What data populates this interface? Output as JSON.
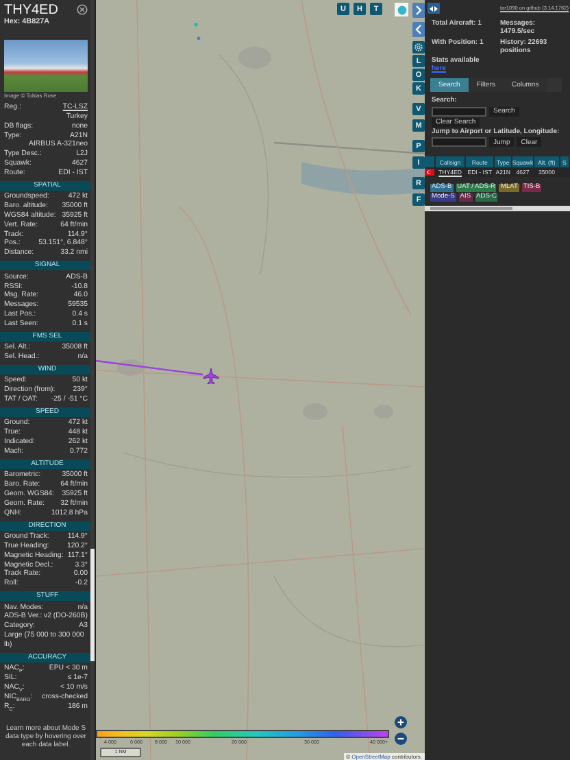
{
  "aircraft": {
    "callsign": "THY4ED",
    "hex": "Hex: 4B827A",
    "photo_credit": "Image © Tobias Rose"
  },
  "details": [
    {
      "kind": "link",
      "label": "Reg.:",
      "value": "TC-LSZ"
    },
    {
      "kind": "note",
      "value": "Turkey"
    },
    {
      "kind": "pair",
      "label": "DB flags:",
      "value": "none"
    },
    {
      "kind": "pair",
      "label": "Type:",
      "value": "A21N"
    },
    {
      "kind": "note",
      "value": "AIRBUS A-321neo"
    },
    {
      "kind": "pair",
      "label": "Type Desc.:",
      "value": "L2J"
    },
    {
      "kind": "pair",
      "label": "Squawk:",
      "value": "4627"
    },
    {
      "kind": "pair",
      "label": "Route:",
      "value": "EDI - IST"
    }
  ],
  "sections": [
    {
      "title": "SPATIAL",
      "rows": [
        {
          "kind": "pair",
          "label": "Groundspeed:",
          "value": "472 kt"
        },
        {
          "kind": "pair",
          "label": "Baro. altitude:",
          "value": "35000 ft"
        },
        {
          "kind": "pair",
          "label": "WGS84 altitude:",
          "value": "35925 ft"
        },
        {
          "kind": "pair",
          "label": "Vert. Rate:",
          "value": "64 ft/min"
        },
        {
          "kind": "pair",
          "label": "Track:",
          "value": "114.9°"
        },
        {
          "kind": "pair",
          "label": "Pos.:",
          "value": "53.151°, 6.848°"
        },
        {
          "kind": "pair",
          "label": "Distance:",
          "value": "33.2 nmi"
        }
      ]
    },
    {
      "title": "SIGNAL",
      "rows": [
        {
          "kind": "pair",
          "label": "Source:",
          "value": "ADS-B"
        },
        {
          "kind": "pair",
          "label": "RSSI:",
          "value": "-10.8"
        },
        {
          "kind": "pair",
          "label": "Msg. Rate:",
          "value": "46.0"
        },
        {
          "kind": "pair",
          "label": "Messages:",
          "value": "59535"
        },
        {
          "kind": "pair",
          "label": "Last Pos.:",
          "value": "0.4 s"
        },
        {
          "kind": "pair",
          "label": "Last Seen:",
          "value": "0.1 s"
        }
      ]
    },
    {
      "title": "FMS SEL",
      "rows": [
        {
          "kind": "pair",
          "label": "Sel. Alt.:",
          "value": "35008 ft"
        },
        {
          "kind": "pair",
          "label": "Sel. Head.:",
          "value": "n/a"
        }
      ]
    },
    {
      "title": "WIND",
      "rows": [
        {
          "kind": "pair",
          "label": "Speed:",
          "value": "50 kt"
        },
        {
          "kind": "pair",
          "label": "Direction (from):",
          "value": "239°"
        },
        {
          "kind": "pair",
          "label": "TAT / OAT:",
          "value": "-25 / -51 °C"
        }
      ]
    },
    {
      "title": "SPEED",
      "rows": [
        {
          "kind": "pair",
          "label": "Ground:",
          "value": "472 kt"
        },
        {
          "kind": "pair",
          "label": "True:",
          "value": "448 kt"
        },
        {
          "kind": "pair",
          "label": "Indicated:",
          "value": "262 kt"
        },
        {
          "kind": "pair",
          "label": "Mach:",
          "value": "0.772"
        }
      ]
    },
    {
      "title": "ALTITUDE",
      "rows": [
        {
          "kind": "pair",
          "label": "Barometric:",
          "value": "35000 ft"
        },
        {
          "kind": "pair",
          "label": "Baro. Rate:",
          "value": "64 ft/min"
        },
        {
          "kind": "pair",
          "label": "Geom. WGS84:",
          "value": "35925 ft"
        },
        {
          "kind": "pair",
          "label": "Geom. Rate:",
          "value": "32 ft/min"
        },
        {
          "kind": "pair",
          "label": "QNH:",
          "value": "1012.8 hPa"
        }
      ]
    },
    {
      "title": "DIRECTION",
      "rows": [
        {
          "kind": "pair",
          "label": "Ground Track:",
          "value": "114.9°"
        },
        {
          "kind": "pair",
          "label": "True Heading:",
          "value": "120.2°"
        },
        {
          "kind": "pair",
          "label": "Magnetic Heading:",
          "value": "117.1°"
        },
        {
          "kind": "pair",
          "label": "Magnetic Decl.:",
          "value": "3.3°"
        },
        {
          "kind": "pair",
          "label": "Track Rate:",
          "value": "0.00"
        },
        {
          "kind": "pair",
          "label": "Roll:",
          "value": "-0.2"
        }
      ]
    },
    {
      "title": "STUFF",
      "rows": [
        {
          "kind": "pair",
          "label": "Nav. Modes:",
          "value": "n/a"
        },
        {
          "kind": "pair",
          "label": "ADS-B Ver.:",
          "value": "v2 (DO-260B)"
        },
        {
          "kind": "pair",
          "label": "Category:",
          "value": "A3"
        },
        {
          "kind": "text",
          "value": "Large (75 000 to 300 000 lb)"
        }
      ]
    },
    {
      "title": "ACCURACY",
      "rows": [
        {
          "kind": "pair",
          "label": "NAC$_{P}$:",
          "value": "EPU < 30 m"
        },
        {
          "kind": "pair",
          "label": "SIL:",
          "value": "≤ 1e-7"
        },
        {
          "kind": "pair",
          "label": "NAC$_{V}$:",
          "value": "< 10 m/s"
        },
        {
          "kind": "pair",
          "label": "NIC$_{BARO}$:",
          "value": "cross-checked"
        },
        {
          "kind": "pair",
          "label": "R$_{C}$:",
          "value": "186 m"
        }
      ]
    }
  ],
  "hint": "Learn more about Mode S data type by hovering over each data label.",
  "map_buttons_top": [
    "U",
    "H",
    "T"
  ],
  "map_buttons_side": [
    [
      {
        "kind": "chevron-right"
      }
    ],
    [
      {
        "kind": "chevron-left"
      }
    ],
    [
      {
        "kind": "gear"
      },
      {
        "kind": "letter",
        "label": "L"
      },
      {
        "kind": "letter",
        "label": "O"
      },
      {
        "kind": "letter",
        "label": "K"
      }
    ],
    [
      {
        "kind": "letter",
        "label": "V"
      },
      {
        "kind": "letter",
        "label": "M"
      }
    ],
    [
      {
        "kind": "letter",
        "label": "P"
      },
      {
        "kind": "letter",
        "label": "I"
      }
    ],
    [
      {
        "kind": "letter",
        "label": "R"
      },
      {
        "kind": "letter",
        "label": "F"
      }
    ]
  ],
  "altitude_legend": [
    "4 000",
    "6 000",
    "8 000",
    "10 000",
    "20 000",
    "30 000",
    "40 000+"
  ],
  "scale": "1 NM",
  "attribution": {
    "prefix": "©",
    "link": "OpenStreetMap",
    "suffix": "contributors."
  },
  "stats": {
    "version_link": "tar1090 on github (3.14.1762)",
    "total": "Total Aircraft: 1",
    "messages": "Messages: 1479.5/sec",
    "with_position": "With Position: 1",
    "history": "History: 22693 positions",
    "stats_text": "Stats available",
    "stats_link": "here"
  },
  "tabs": [
    {
      "label": "Search",
      "selected": true
    },
    {
      "label": "Filters",
      "selected": false
    },
    {
      "label": "Columns",
      "selected": false
    }
  ],
  "search": {
    "label": "Search:",
    "button": "Search",
    "clear": "Clear Search",
    "jump_label": "Jump to Airport or Latitude, Longitude:",
    "jump": "Jump",
    "jump_clear": "Clear"
  },
  "table": {
    "columns": [
      "",
      "Callsign",
      "Route",
      "Type",
      "Squawk",
      "Alt. (ft)",
      "S"
    ],
    "rows": [
      {
        "cells": [
          "",
          "THY4ED",
          "EDI - IST",
          "A21N",
          "4627",
          "35000",
          ""
        ]
      }
    ]
  },
  "sources": [
    {
      "label": "ADS-B",
      "color": "#2f6f8f"
    },
    {
      "label": "UAT / ADS-R",
      "color": "#2f7a4a"
    },
    {
      "label": "MLAT",
      "color": "#7a6a2a"
    },
    {
      "label": "TIS-B",
      "color": "#7a2a48"
    },
    {
      "label": "Mode-S",
      "color": "#3a3a88"
    },
    {
      "label": "AIS",
      "color": "#6a2a4a"
    },
    {
      "label": "ADS-C",
      "color": "#2a6a48"
    }
  ]
}
